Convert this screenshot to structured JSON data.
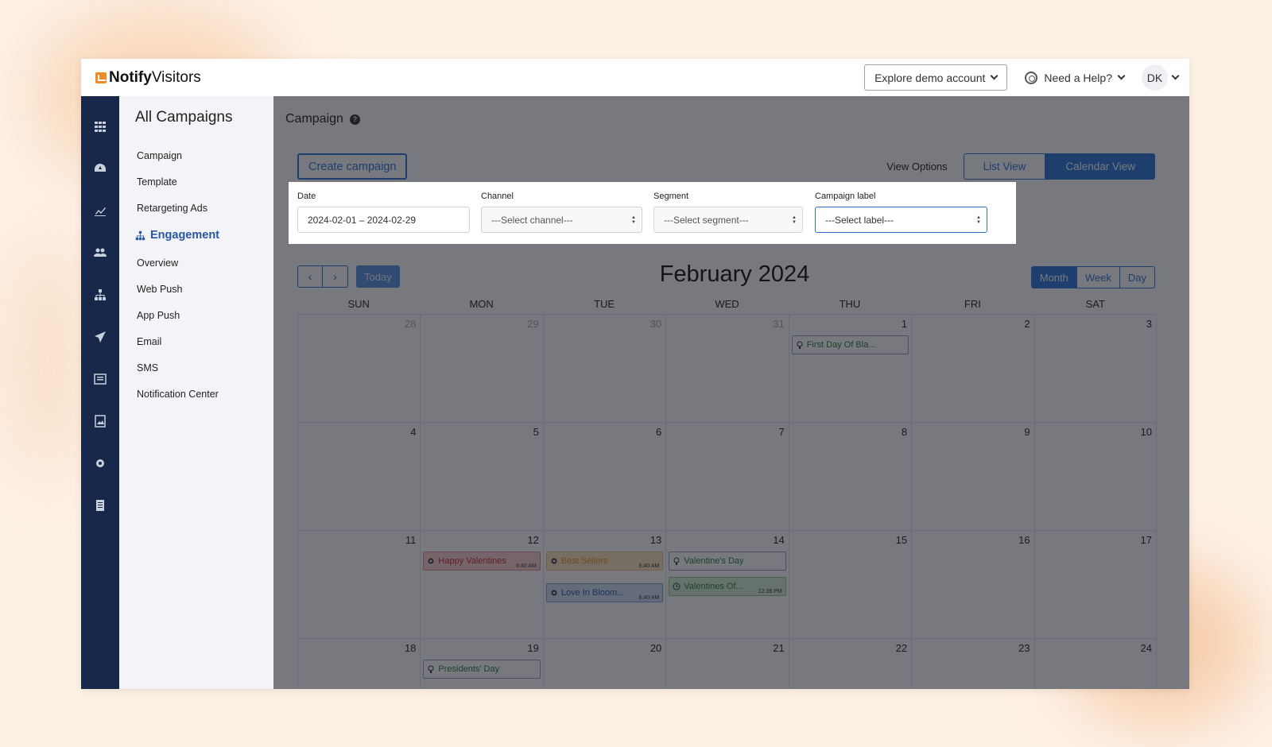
{
  "brand": {
    "name_bold": "Notify",
    "name_rest": "Visitors",
    "accent": "#2d73d8",
    "logo_color": "#f08a24"
  },
  "header": {
    "demo_button": "Explore demo account",
    "help_label": "Need a Help?",
    "user_initials": "DK"
  },
  "rail_icons": [
    "grid-icon",
    "dashboard-icon",
    "analytics-icon",
    "users-icon",
    "hierarchy-icon",
    "send-icon",
    "list-icon",
    "image-icon",
    "settings-icon",
    "document-icon"
  ],
  "sidebar": {
    "title": "All Campaigns",
    "items": [
      "Campaign",
      "Template",
      "Retargeting Ads"
    ],
    "section": "Engagement",
    "sub_items": [
      "Overview",
      "Web Push",
      "App Push",
      "Email",
      "SMS",
      "Notification Center"
    ]
  },
  "main": {
    "title": "Campaign",
    "create_button": "Create campaign",
    "view_options_label": "View Options",
    "list_view": "List View",
    "calendar_view": "Calendar View"
  },
  "filters": {
    "date_label": "Date",
    "date_value": "2024-02-01 – 2024-02-29",
    "channel_label": "Channel",
    "channel_value": "---Select channel---",
    "segment_label": "Segment",
    "segment_value": "---Select segment---",
    "campaign_label_label": "Campaign label",
    "campaign_label_value": "---Select label---"
  },
  "calendar": {
    "today": "Today",
    "title": "February 2024",
    "ranges": [
      "Month",
      "Week",
      "Day"
    ],
    "days_of_week": [
      "SUN",
      "MON",
      "TUE",
      "WED",
      "THU",
      "FRI",
      "SAT"
    ],
    "weeks": [
      [
        {
          "n": "28",
          "other": true
        },
        {
          "n": "29",
          "other": true
        },
        {
          "n": "30",
          "other": true
        },
        {
          "n": "31",
          "other": true
        },
        {
          "n": "1"
        },
        {
          "n": "2"
        },
        {
          "n": "3"
        }
      ],
      [
        {
          "n": "4"
        },
        {
          "n": "5"
        },
        {
          "n": "6"
        },
        {
          "n": "7"
        },
        {
          "n": "8"
        },
        {
          "n": "9"
        },
        {
          "n": "10"
        }
      ],
      [
        {
          "n": "11"
        },
        {
          "n": "12"
        },
        {
          "n": "13"
        },
        {
          "n": "14"
        },
        {
          "n": "15"
        },
        {
          "n": "16"
        },
        {
          "n": "17"
        }
      ],
      [
        {
          "n": "18"
        },
        {
          "n": "19"
        },
        {
          "n": "20"
        },
        {
          "n": "21"
        },
        {
          "n": "22"
        },
        {
          "n": "23"
        },
        {
          "n": "24"
        }
      ]
    ],
    "events": [
      {
        "week": 0,
        "day": 4,
        "slot": 0,
        "type": "holiday",
        "icon": "bulb-icon",
        "label": "First Day Of Bla..."
      },
      {
        "week": 2,
        "day": 1,
        "slot": 0,
        "type": "red",
        "icon": "gear-icon",
        "label": "Happy Valentines",
        "time": "6:40 AM"
      },
      {
        "week": 2,
        "day": 2,
        "slot": 0,
        "type": "orange",
        "icon": "gear-icon",
        "label": "Best Sellers",
        "time": "6:40 AM"
      },
      {
        "week": 2,
        "day": 2,
        "slot": 1,
        "type": "blue",
        "icon": "gear-icon",
        "label": "Love In Bloom...",
        "time": "6:40 AM"
      },
      {
        "week": 2,
        "day": 3,
        "slot": 0,
        "type": "holiday",
        "icon": "bulb-icon",
        "label": "Valentine's Day"
      },
      {
        "week": 2,
        "day": 3,
        "slot": 1,
        "type": "green",
        "icon": "clock-icon",
        "label": "Valentines Of...",
        "time": "12:39 PM"
      },
      {
        "week": 3,
        "day": 1,
        "slot": 0,
        "type": "holiday",
        "icon": "bulb-icon",
        "label": "Presidents' Day"
      }
    ]
  }
}
